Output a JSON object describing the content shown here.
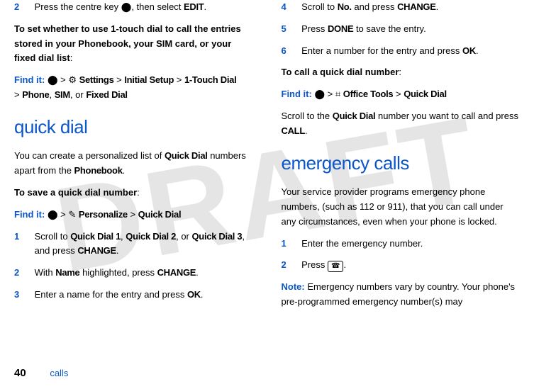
{
  "watermark": "DRAFT",
  "left": {
    "step2_num": "2",
    "step2_text_a": "Press the centre key ",
    "step2_text_b": ", then select ",
    "step2_edit": "EDIT",
    "step2_text_c": ".",
    "para1": "To set whether to use 1-touch dial to call the entries stored in your Phonebook, your SIM card, or your fixed dial list",
    "para1_colon": ":",
    "findit_label": "Find it:",
    "findit_path_a": " > ",
    "findit_settings": "Settings",
    "findit_path_b": " > ",
    "findit_initial": "Initial Setup",
    "findit_path_c": " > ",
    "findit_onetouch": "1-Touch Dial",
    "findit_path_d": " > ",
    "findit_phone": "Phone",
    "findit_sep1": ", ",
    "findit_sim": "SIM",
    "findit_sep2": ", or ",
    "findit_fixed": "Fixed Dial",
    "heading_quick": "quick dial",
    "para2_a": "You can create a personalized list of ",
    "para2_qd": "Quick Dial",
    "para2_b": " numbers apart from the ",
    "para2_pb": "Phonebook",
    "para2_c": ".",
    "para3": "To save a quick dial number",
    "para3_colon": ":",
    "findit2_pers": "Personalize",
    "findit2_qd": "Quick Dial",
    "s1_num": "1",
    "s1_a": "Scroll to ",
    "s1_qd1": "Quick Dial 1",
    "s1_sep1": ", ",
    "s1_qd2": "Quick Dial 2",
    "s1_sep2": ", or ",
    "s1_qd3": "Quick Dial 3",
    "s1_b": ", and press ",
    "s1_change": "CHANGE",
    "s1_c": ".",
    "s2_num": "2",
    "s2_a": "With ",
    "s2_name": "Name",
    "s2_b": " highlighted, press ",
    "s2_change": "CHANGE",
    "s2_c": ".",
    "s3_num": "3",
    "s3_a": "Enter a name for the entry and press ",
    "s3_ok": "OK",
    "s3_b": "."
  },
  "right": {
    "s4_num": "4",
    "s4_a": "Scroll to ",
    "s4_no": "No.",
    "s4_b": " and press ",
    "s4_change": "CHANGE",
    "s4_c": ".",
    "s5_num": "5",
    "s5_a": "Press ",
    "s5_done": "DONE",
    "s5_b": " to save the entry.",
    "s6_num": "6",
    "s6_a": "Enter a number for the entry and press ",
    "s6_ok": "OK",
    "s6_b": ".",
    "para4": "To call a quick dial number",
    "para4_colon": ":",
    "findit3_office": "Office Tools",
    "findit3_qd": "Quick Dial",
    "para5_a": "Scroll to the ",
    "para5_qd": "Quick Dial",
    "para5_b": " number you want to call and press ",
    "para5_call": "CALL",
    "para5_c": ".",
    "heading_emerg": "emergency calls",
    "para6": "Your service provider programs emergency phone numbers, (such as 112 or 911), that you can call under any circumstances, even when your phone is locked.",
    "e1_num": "1",
    "e1_text": "Enter the emergency number.",
    "e2_num": "2",
    "e2_a": "Press ",
    "e2_b": ".",
    "note_label": "Note:",
    "note_text": " Emergency numbers vary by country. Your phone's pre-programmed emergency number(s) may"
  },
  "footer": {
    "page": "40",
    "label": "calls"
  },
  "icons": {
    "center_key": "•",
    "settings": "⚙",
    "personalize": "✎",
    "office": "⌗",
    "send": "☎",
    "gt": ">"
  }
}
